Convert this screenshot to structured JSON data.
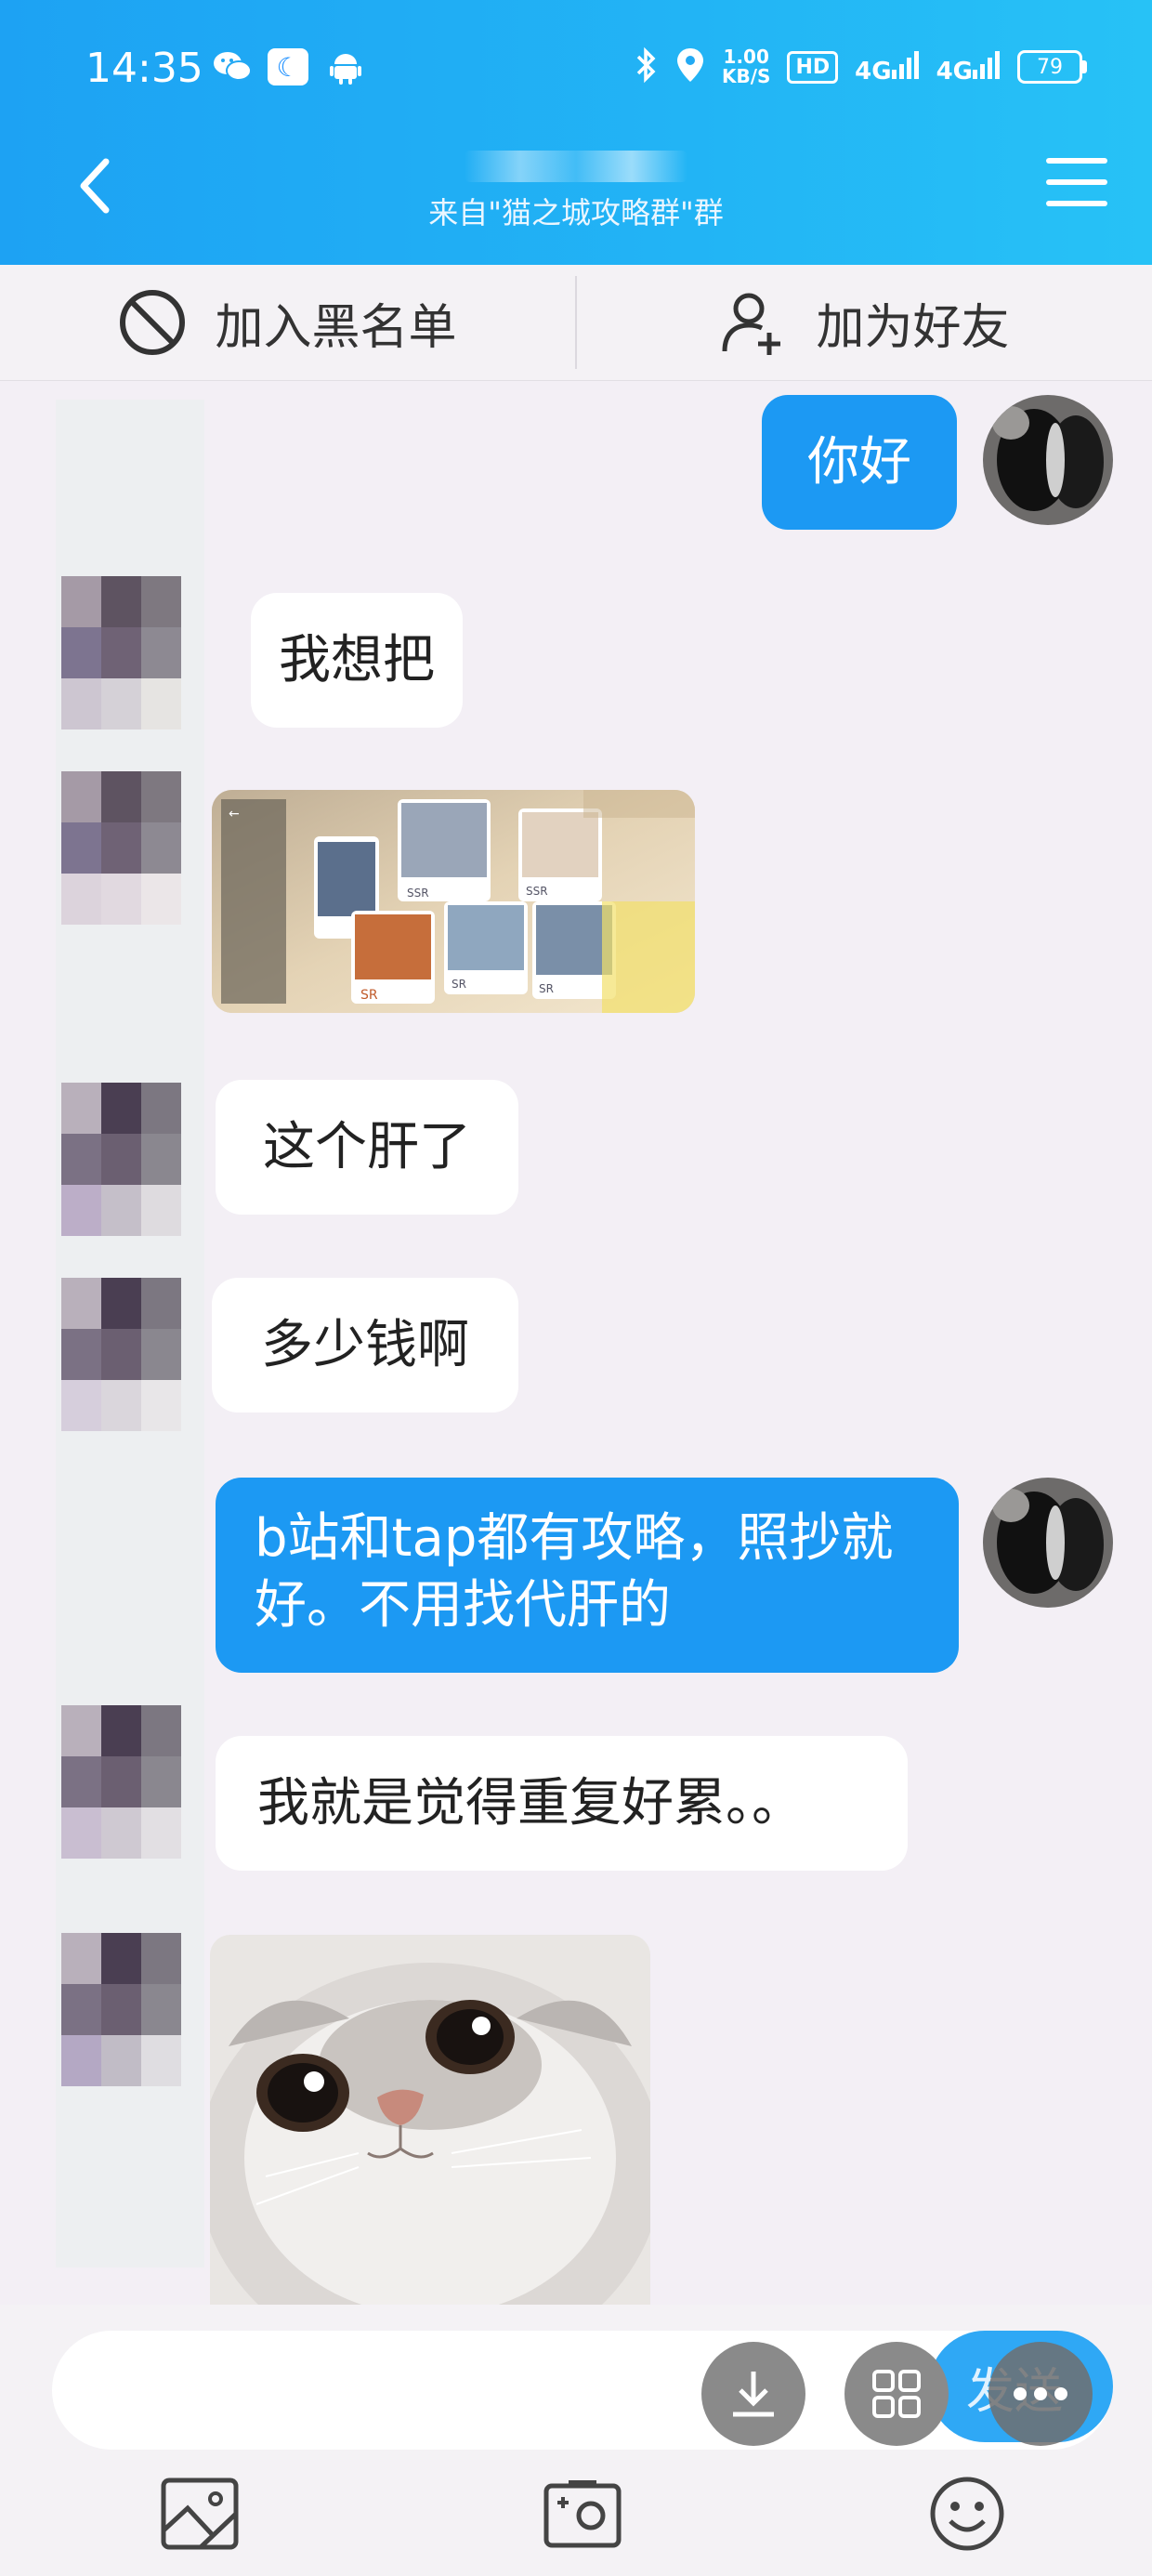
{
  "statusbar": {
    "time": "14:35",
    "speed_value": "1.00",
    "speed_unit": "KB/S",
    "hd": "HD",
    "net1": "4G",
    "net2": "4G",
    "battery": "79"
  },
  "header": {
    "subtitle": "来自\"猫之城攻略群\"群"
  },
  "actions": {
    "blacklist": "加入黑名单",
    "add_friend": "加为好友"
  },
  "messages": [
    {
      "from": "me",
      "text": "你好"
    },
    {
      "from": "them",
      "text": "我想把"
    },
    {
      "from": "them",
      "type": "image",
      "description": "game screenshot"
    },
    {
      "from": "them",
      "text": "这个肝了"
    },
    {
      "from": "them",
      "text": "多少钱啊"
    },
    {
      "from": "me",
      "text": "b站和tap都有攻略，照抄就好。不用找代肝的"
    },
    {
      "from": "them",
      "text": "我就是觉得重复好累。。"
    },
    {
      "from": "them",
      "type": "image",
      "description": "cat sticker"
    }
  ],
  "game_image": {
    "card_labels": [
      "SR",
      "SSR",
      "SR",
      "SSR",
      "SR"
    ]
  },
  "input": {
    "send_label": "发送",
    "placeholder": ""
  },
  "colors": {
    "header": "#1da2f3",
    "my_bubble": "#1c99f3",
    "background": "#f3eff5"
  }
}
